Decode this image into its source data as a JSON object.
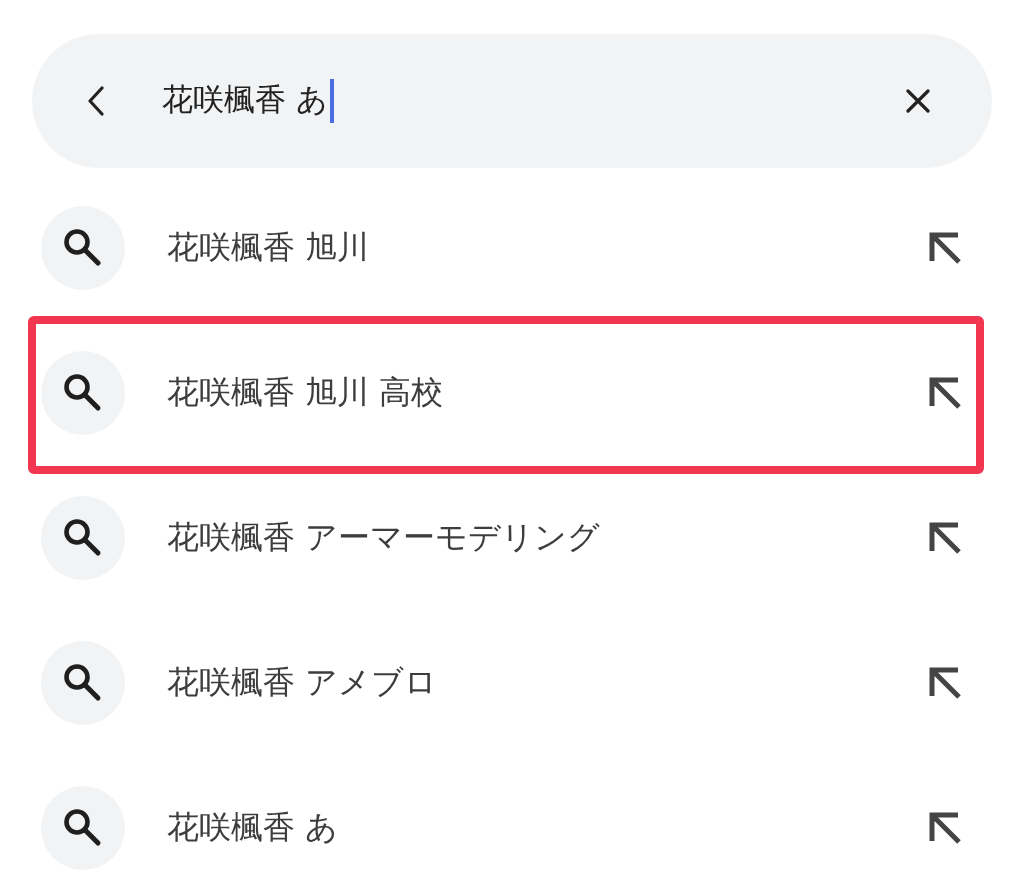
{
  "search": {
    "value": "花咲楓香 あ",
    "focused": true
  },
  "suggestions": [
    {
      "text": "花咲楓香 旭川",
      "highlighted": false
    },
    {
      "text": "花咲楓香 旭川 高校",
      "highlighted": true
    },
    {
      "text": "花咲楓香 アーマーモデリング",
      "highlighted": false
    },
    {
      "text": "花咲楓香 アメブロ",
      "highlighted": false
    },
    {
      "text": "花咲楓香 あ",
      "highlighted": false
    }
  ]
}
